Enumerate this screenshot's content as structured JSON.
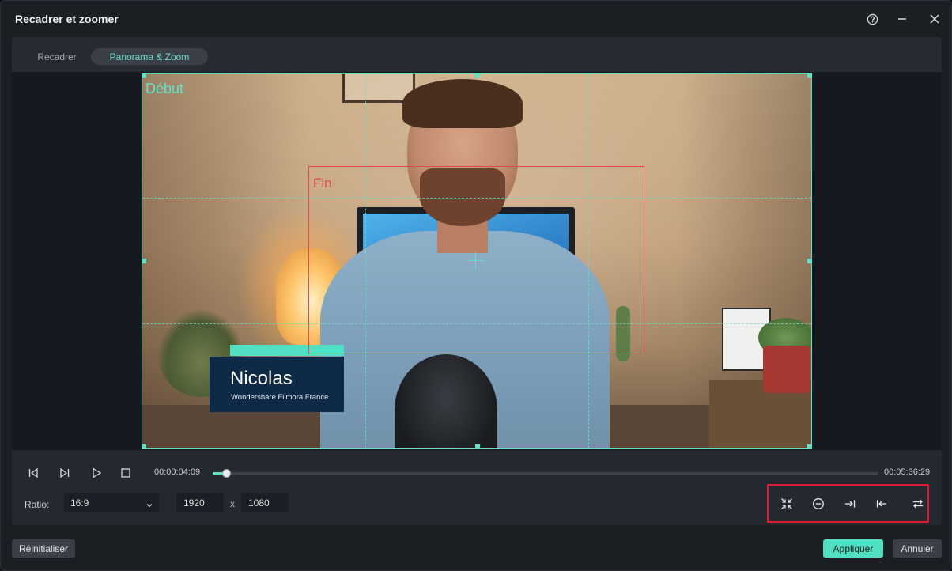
{
  "window": {
    "title": "Recadrer et zoomer"
  },
  "tabs": [
    {
      "label": "Recadrer",
      "active": false
    },
    {
      "label": "Panorama & Zoom",
      "active": true
    }
  ],
  "preview": {
    "start_frame_label": "Début",
    "end_frame_label": "Fin",
    "lower_third": {
      "name": "Nicolas",
      "subtitle": "Wondershare Filmora France"
    }
  },
  "playback": {
    "current_time": "00:00:04:09",
    "total_time": "00:05:36:29",
    "progress": 0.02
  },
  "ratio": {
    "label": "Ratio:",
    "selected": "16:9",
    "width": "1920",
    "separator": "x",
    "height": "1080"
  },
  "tools": [
    {
      "icon": "fit-to-screen-icon"
    },
    {
      "icon": "zoom-out-icon"
    },
    {
      "icon": "match-end-to-start-icon"
    },
    {
      "icon": "match-start-to-end-icon"
    },
    {
      "icon": "swap-start-end-icon"
    }
  ],
  "footer": {
    "reset_label": "Réinitialiser",
    "apply_label": "Appliquer",
    "cancel_label": "Annuler"
  },
  "colors": {
    "accent": "#52e0c4",
    "start_frame": "#5ee3c6",
    "end_frame": "#e0484d",
    "highlight": "#e21c2a"
  }
}
